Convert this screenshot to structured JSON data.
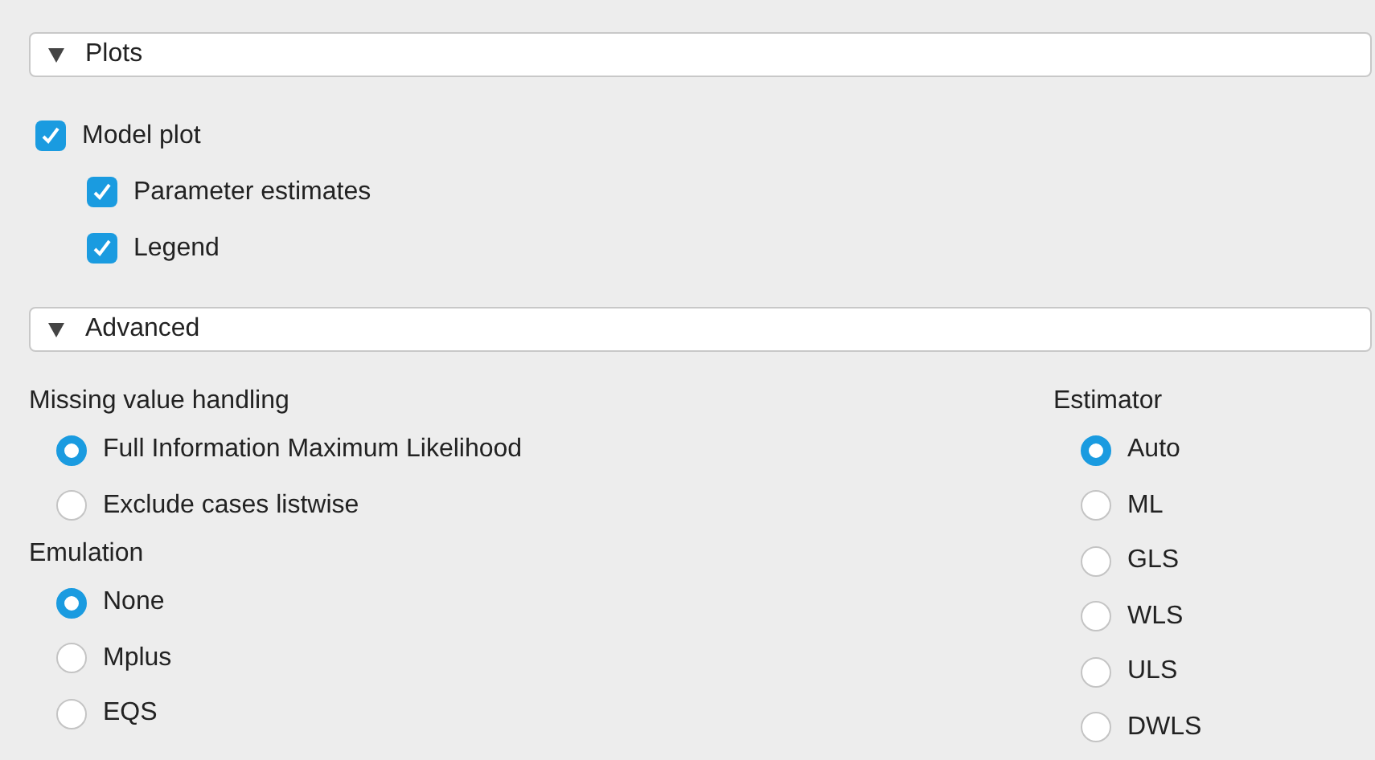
{
  "plots": {
    "title": "Plots",
    "expanded": true,
    "options": [
      {
        "label": "Model plot",
        "checked": true,
        "children": [
          {
            "label": "Parameter estimates",
            "checked": true
          },
          {
            "label": "Legend",
            "checked": true
          }
        ]
      }
    ]
  },
  "advanced": {
    "title": "Advanced",
    "expanded": true,
    "left_groups": [
      {
        "title": "Missing value handling",
        "options": [
          {
            "label": "Full Information Maximum Likelihood",
            "selected": true
          },
          {
            "label": "Exclude cases listwise",
            "selected": false
          }
        ]
      },
      {
        "title": "Emulation",
        "options": [
          {
            "label": "None",
            "selected": true
          },
          {
            "label": "Mplus",
            "selected": false
          },
          {
            "label": "EQS",
            "selected": false
          }
        ]
      }
    ],
    "right_groups": [
      {
        "title": "Estimator",
        "options": [
          {
            "label": "Auto",
            "selected": true
          },
          {
            "label": "ML",
            "selected": false
          },
          {
            "label": "GLS",
            "selected": false
          },
          {
            "label": "WLS",
            "selected": false
          },
          {
            "label": "ULS",
            "selected": false
          },
          {
            "label": "DWLS",
            "selected": false
          }
        ]
      }
    ]
  }
}
